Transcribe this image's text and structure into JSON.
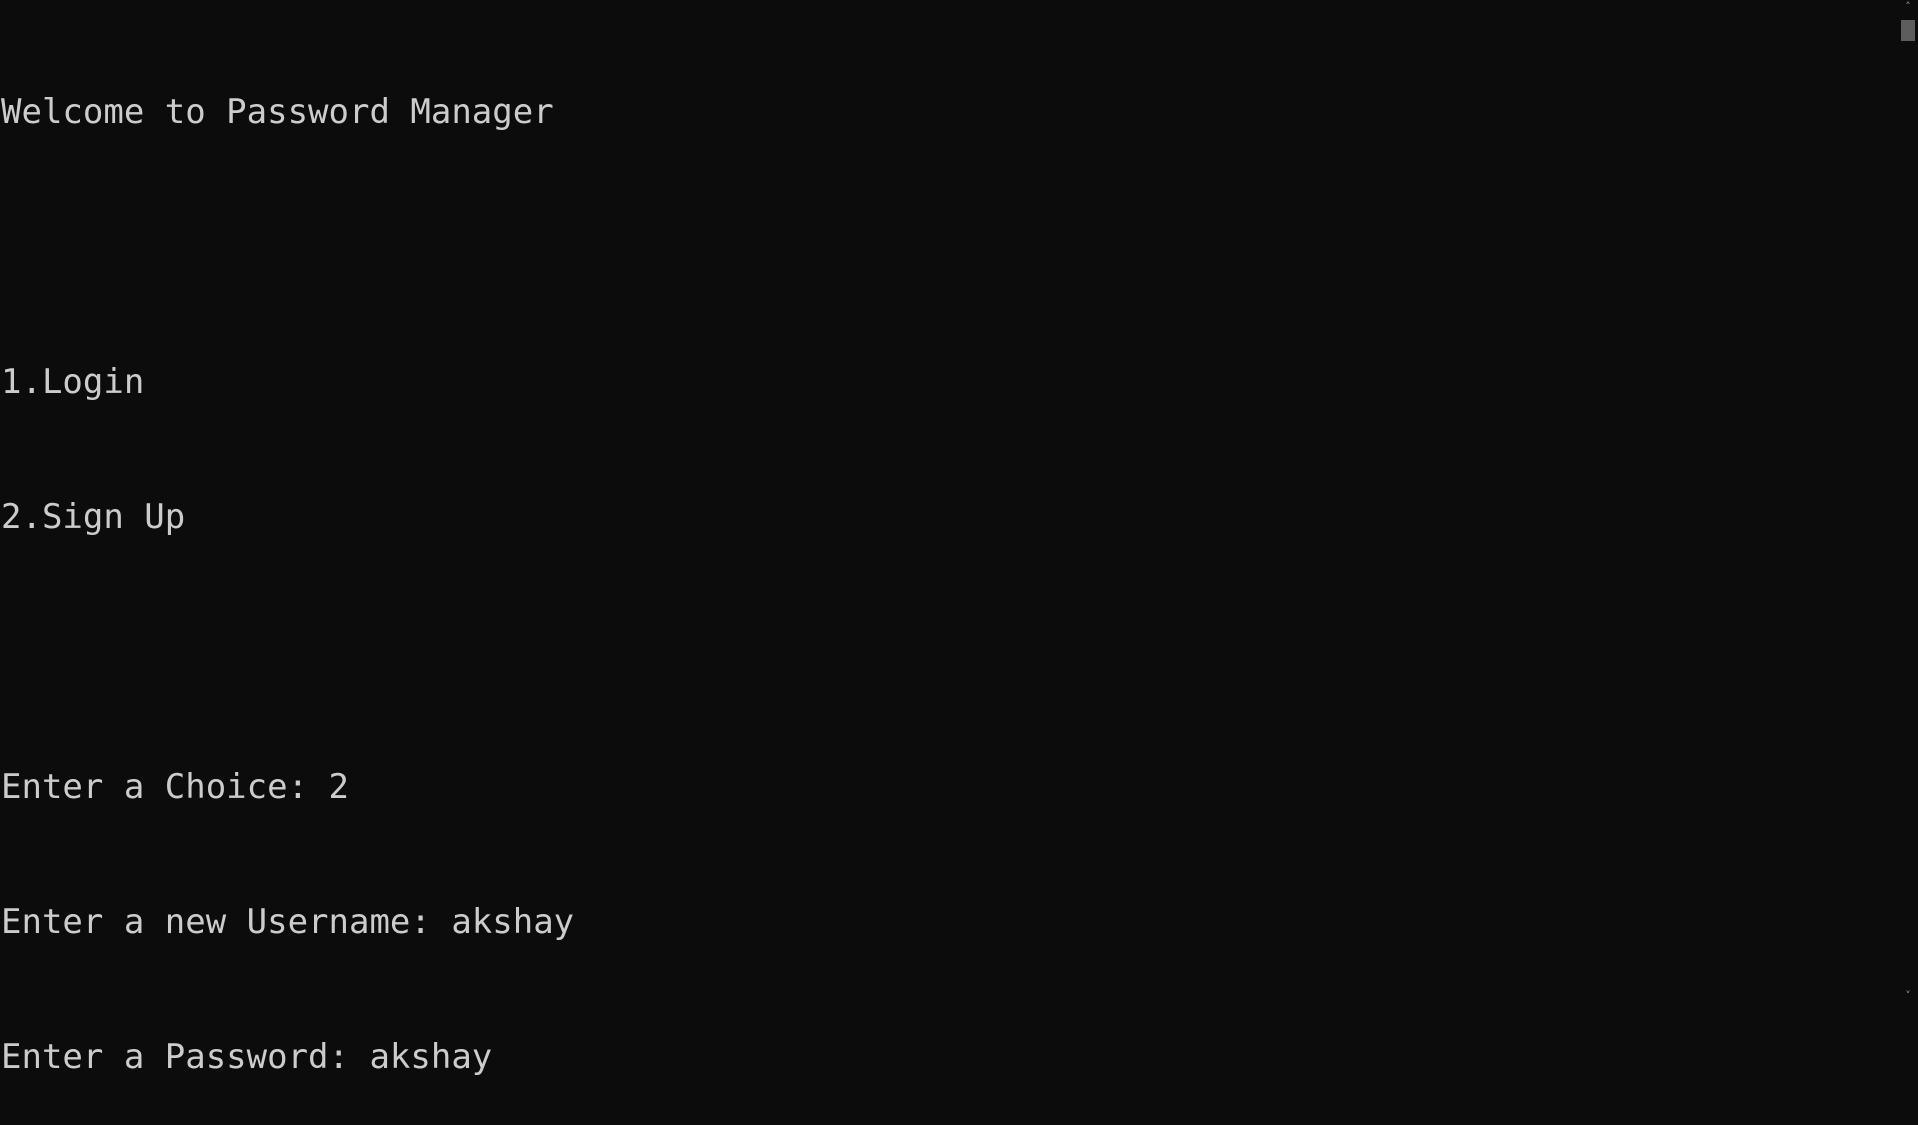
{
  "console": {
    "lines": [
      "Welcome to Password Manager",
      "",
      "1.Login",
      "2.Sign Up",
      "",
      "Enter a Choice: 2",
      "Enter a new Username: akshay",
      "Enter a Password: akshay"
    ]
  },
  "scrollbar": {
    "up_icon": "˄",
    "down_icon": "˅"
  },
  "colors": {
    "background": "#0c0c0c",
    "text": "#cccccc",
    "scroll_thumb": "#5d5d5d"
  }
}
